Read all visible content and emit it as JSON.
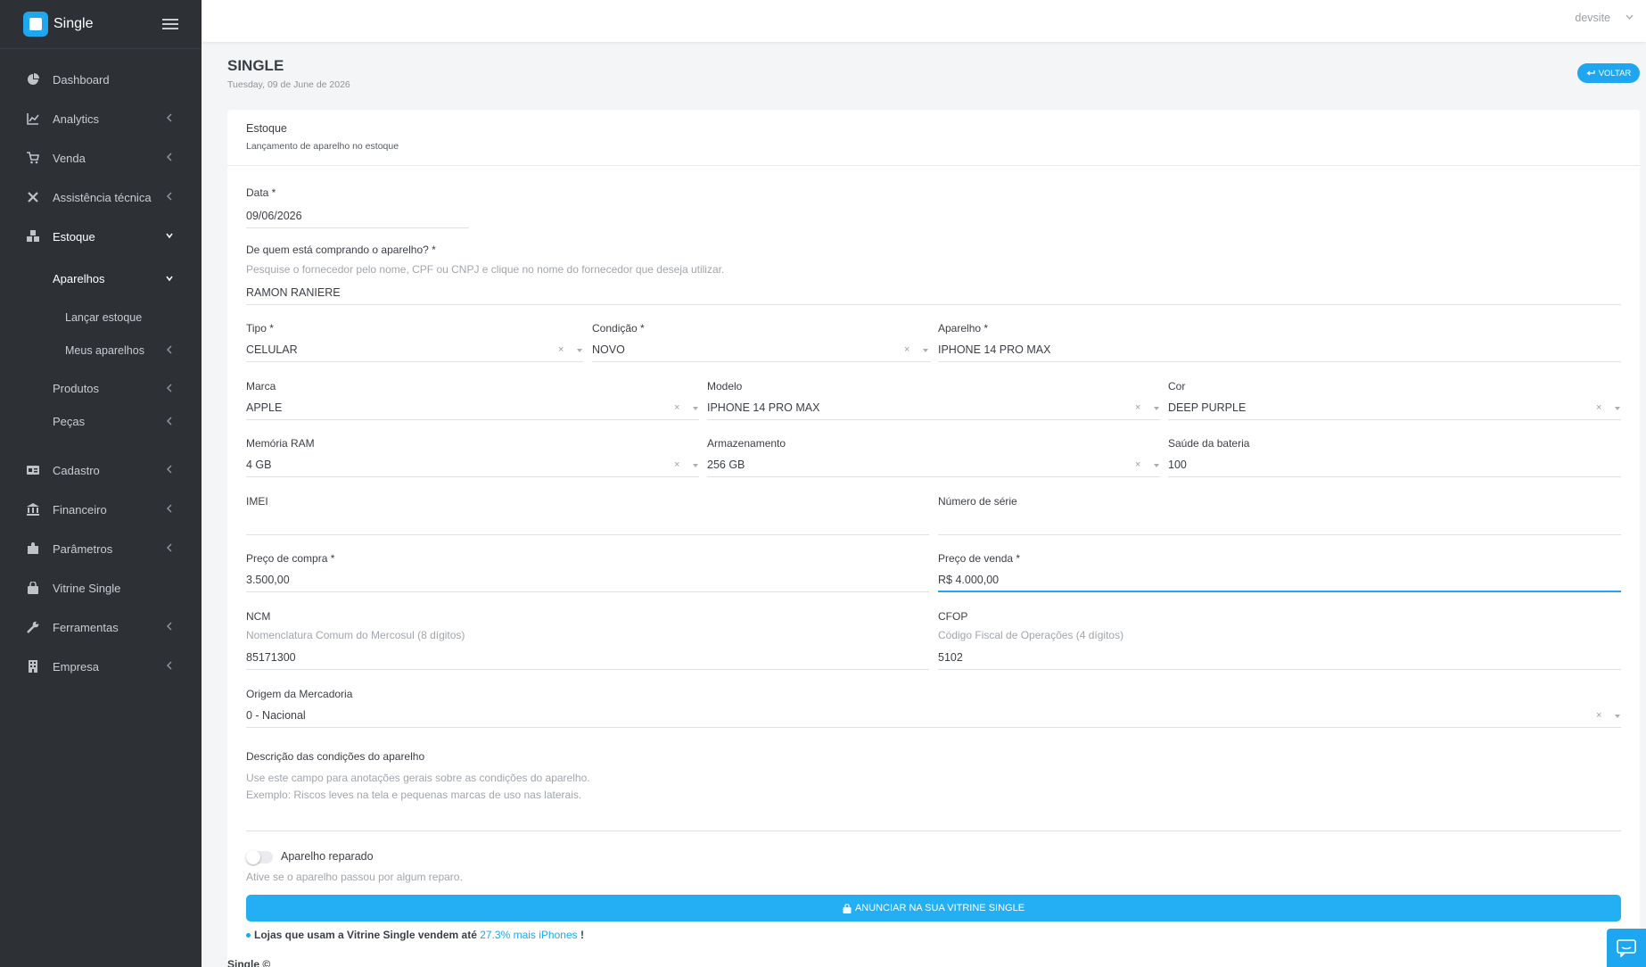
{
  "app": {
    "brand": "Single",
    "user": "devsite"
  },
  "sidebar": {
    "items": [
      {
        "label": "Dashboard",
        "icon": "pie-chart-icon"
      },
      {
        "label": "Analytics",
        "icon": "line-chart-icon"
      },
      {
        "label": "Venda",
        "icon": "cart-icon"
      },
      {
        "label": "Assistência técnica",
        "icon": "tools-icon"
      },
      {
        "label": "Estoque",
        "icon": "boxes-icon"
      },
      {
        "label": "Aparelhos"
      },
      {
        "label": "Lançar estoque"
      },
      {
        "label": "Meus aparelhos"
      },
      {
        "label": "Produtos"
      },
      {
        "label": "Peças"
      },
      {
        "label": "Cadastro",
        "icon": "id-card-icon"
      },
      {
        "label": "Financeiro",
        "icon": "bank-icon"
      },
      {
        "label": "Parâmetros",
        "icon": "puzzle-icon"
      },
      {
        "label": "Vitrine Single",
        "icon": "bag-icon"
      },
      {
        "label": "Ferramentas",
        "icon": "wrench-icon"
      },
      {
        "label": "Empresa",
        "icon": "building-icon"
      }
    ]
  },
  "page": {
    "title": "SINGLE",
    "date": "Tuesday, 09 de June de 2026",
    "back_label": "VOLTAR"
  },
  "card": {
    "title": "Estoque",
    "subtitle": "Lançamento de aparelho no estoque"
  },
  "form": {
    "data": {
      "label": "Data *",
      "value": "09/06/2026"
    },
    "fornecedor": {
      "label": "De quem está comprando o aparelho? *",
      "help": "Pesquise o fornecedor pelo nome, CPF ou CNPJ e clique no nome do fornecedor que deseja utilizar.",
      "value": "RAMON RANIERE"
    },
    "tipo": {
      "label": "Tipo *",
      "value": "CELULAR"
    },
    "condicao": {
      "label": "Condição *",
      "value": "NOVO"
    },
    "aparelho": {
      "label": "Aparelho *",
      "value": "IPHONE 14 PRO MAX"
    },
    "marca": {
      "label": "Marca",
      "value": "APPLE"
    },
    "modelo": {
      "label": "Modelo",
      "value": "IPHONE 14 PRO MAX"
    },
    "cor": {
      "label": "Cor",
      "value": "DEEP PURPLE"
    },
    "ram": {
      "label": "Memória RAM",
      "value": "4 GB"
    },
    "armazenamento": {
      "label": "Armazenamento",
      "value": "256 GB"
    },
    "bateria": {
      "label": "Saúde da bateria",
      "value": "100"
    },
    "imei": {
      "label": "IMEI",
      "value": ""
    },
    "serie": {
      "label": "Número de série",
      "value": ""
    },
    "preco_compra": {
      "label": "Preço de compra *",
      "value": "3.500,00"
    },
    "preco_venda": {
      "label": "Preço de venda *",
      "value": "R$ 4.000,00"
    },
    "ncm": {
      "label": "NCM",
      "help": "Nomenclatura Comum do Mercosul (8 dígitos)",
      "value": "85171300"
    },
    "cfop": {
      "label": "CFOP",
      "help": "Código Fiscal de Operações (4 dígitos)",
      "value": "5102"
    },
    "origem": {
      "label": "Origem da Mercadoria",
      "value": "0 - Nacional"
    },
    "descricao": {
      "label": "Descrição das condições do aparelho",
      "placeholder_line1": "Use este campo para anotações gerais sobre as condições do aparelho.",
      "placeholder_line2": "Exemplo: Riscos leves na tela e pequenas marcas de uso nas laterais."
    },
    "reparado": {
      "label": "Aparelho reparado",
      "help": "Ative se o aparelho passou por algum reparo.",
      "checked": false
    },
    "vitrine_button": "ANUNCIAR NA SUA VITRINE SINGLE",
    "promo_before": "Lojas que usam a Vitrine Single vendem até",
    "promo_highlight": "27.3% mais iPhones",
    "promo_after": "!"
  },
  "footer": {
    "text": "Single ©"
  },
  "colors": {
    "accent": "#1ea7f0",
    "sidebar_bg": "#2d3136"
  }
}
